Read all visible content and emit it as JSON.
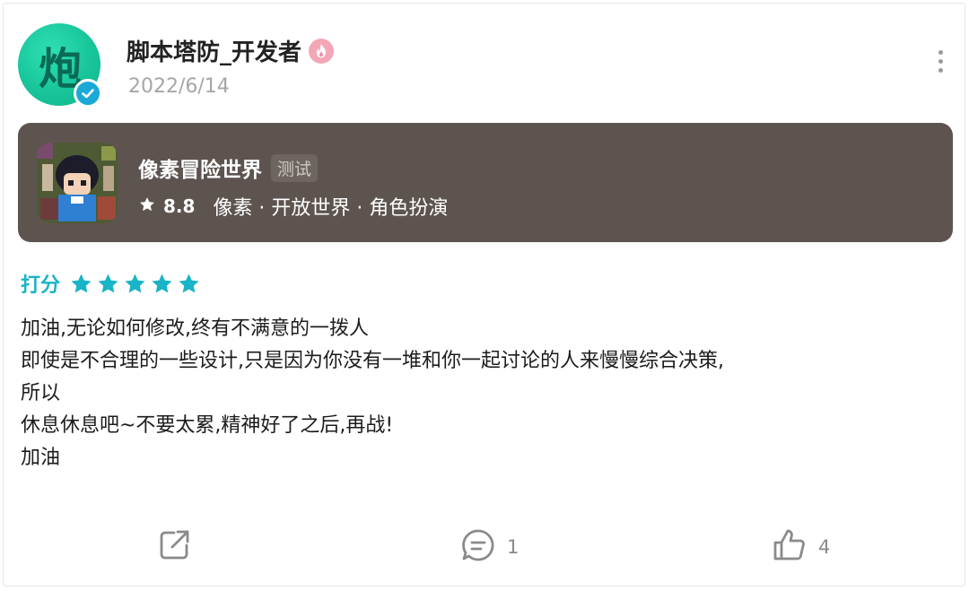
{
  "post": {
    "author": {
      "name": "脚本塔防_开发者",
      "avatar_text": "炮",
      "date": "2022/6/14"
    },
    "game": {
      "name": "像素冒险世界",
      "tag": "测试",
      "score": "8.8",
      "genres": "像素 · 开放世界 · 角色扮演"
    },
    "rating": {
      "label": "打分",
      "stars": 5
    },
    "content": "加油,无论如何修改,终有不满意的一拨人\n即使是不合理的一些设计,只是因为你没有一堆和你一起讨论的人来慢慢综合决策,\n所以\n休息休息吧~不要太累,精神好了之后,再战!\n加油",
    "actions": {
      "comment_count": "1",
      "like_count": "4"
    }
  },
  "colors": {
    "accent": "#18b4c7",
    "game_card_bg": "#5d5450",
    "avatar": "#18c59a",
    "icon_gray": "#8a8a8a"
  },
  "icons": [
    "verified-icon",
    "flame-badge-icon",
    "more-icon",
    "star-icon",
    "share-icon",
    "comment-icon",
    "like-icon"
  ]
}
